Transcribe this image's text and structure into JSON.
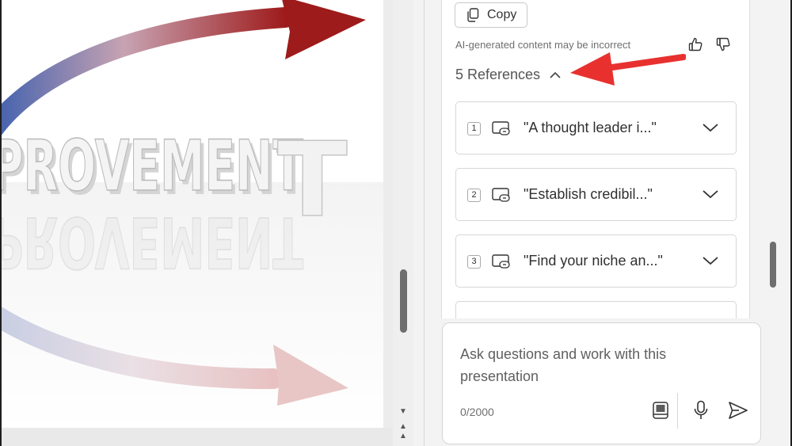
{
  "slide": {
    "word_art": "PROVEMENT",
    "word_art_reflection": "PROVEMENT",
    "word_art_tail": "T"
  },
  "chat": {
    "copy_label": "Copy",
    "disclaimer": "AI-generated content may be incorrect",
    "references_label": "5 References",
    "references": [
      {
        "num": "1",
        "text": "\"A thought leader i...\""
      },
      {
        "num": "2",
        "text": "\"Establish credibil...\""
      },
      {
        "num": "3",
        "text": "\"Find your niche an...\""
      }
    ]
  },
  "input": {
    "placeholder": "Ask questions and work with this presentation",
    "char_count": "0/2000"
  },
  "icons": {
    "copy": "copy-icon",
    "thumb_up": "thumbs-up-icon",
    "thumb_down": "thumbs-down-icon",
    "chevron_up": "chevron-up-icon",
    "chevron_down": "chevron-down-icon",
    "link_card": "link-card-icon",
    "prompts": "prompt-guide-icon",
    "mic": "microphone-icon",
    "send": "send-icon"
  },
  "colors": {
    "annotation_arrow": "#e8312f",
    "arrow_red": "#9e1b1b",
    "arrow_blue": "#3f5fae"
  }
}
